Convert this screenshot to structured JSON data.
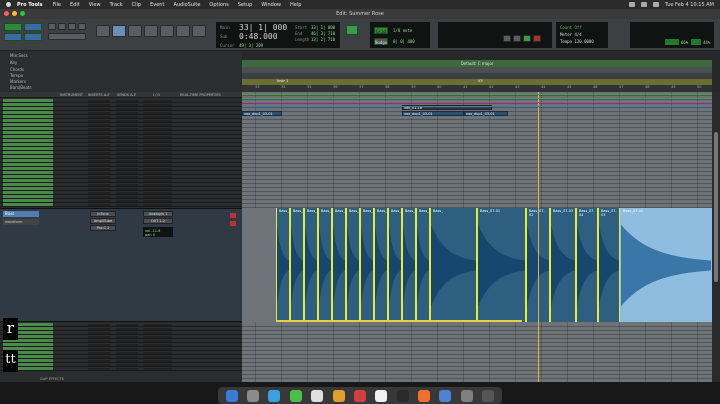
{
  "menubar": {
    "app_name": "Pro Tools",
    "items": [
      "File",
      "Edit",
      "View",
      "Track",
      "Clip",
      "Event",
      "AudioSuite",
      "Options",
      "Setup",
      "Window",
      "Help"
    ],
    "clock": "Tue Feb 4  10:15 AM"
  },
  "window": {
    "title": "Edit: Summer Rose"
  },
  "counters": {
    "main_label": "Main",
    "main_value": "33| 1| 000",
    "sub_label": "Sub",
    "sub_value": "0:48.000",
    "start_label": "Start",
    "start_value": "33| 1| 000",
    "end_label": "End",
    "end_value": "46| 3| 718",
    "length_label": "Length",
    "length_value": "13| 2| 718",
    "cursor_label": "Cursor",
    "cursor_value": "49| 3| 209",
    "nudge_label": "Nudge",
    "nudge_value": "0| 0| 480",
    "grid_label": "Grid",
    "grid_value": "1/8 note",
    "bpm": "Tempo  120.0000",
    "meter": "Meter  4/4",
    "count_off": "Count Off",
    "pct_a": "66%",
    "pct_b": "44%"
  },
  "rulers": {
    "labels": [
      "Min:Secs",
      "Key",
      "Chords",
      "Tempo",
      "Markers",
      "Bars|Beats"
    ],
    "key_text": "Default: C major",
    "marker_a": "Instr 1",
    "marker_b": "V3",
    "bar_ticks": [
      "33",
      "34",
      "35",
      "36",
      "37",
      "38",
      "39",
      "40",
      "41",
      "42",
      "43",
      "44",
      "45",
      "46",
      "47",
      "48",
      "49",
      "50"
    ]
  },
  "columns": [
    "INSTRUMENT",
    "INSERTS A-E",
    "SENDS A-E",
    "I / O",
    "REAL-TIME PROPERTIES"
  ],
  "big_track": {
    "name": "Bass",
    "plugins": [
      "InTune",
      "AmpliTube",
      "Pro-C 2"
    ],
    "io_in": "Analogin 1",
    "io_out": "OUT 1-2",
    "vol": "vol  -11.6",
    "pan": "pan  0",
    "view": "waveform"
  },
  "clips": {
    "upper": [
      "vox_01-16",
      "vox_dup1_03-01",
      "vox_dup1_03-01",
      "vox_dup1_03-01"
    ],
    "bass": [
      "Bass_",
      "Bass_",
      "Bass_",
      "Bass_",
      "Bass_",
      "Bass_",
      "Bass_",
      "Bass_",
      "Bass_",
      "Bass_",
      "Bass_",
      "Bass_",
      "Bass_07-01",
      "Bass_07-02",
      "Bass_07-03",
      "Bass_07-04",
      "Bass_07-03",
      "Bass_07-02"
    ]
  },
  "bottom": {
    "clip_effects": "CLIP EFFECTS"
  },
  "overlay": {
    "char_top": "r",
    "char_bottom": "tt"
  },
  "colors": {
    "green_track": "#4a8a4a",
    "blue_track": "#4f7fb0",
    "clip_blue": "#2f5f80",
    "selected_clip": "#8fbde0",
    "select_border": "#eaea33"
  }
}
